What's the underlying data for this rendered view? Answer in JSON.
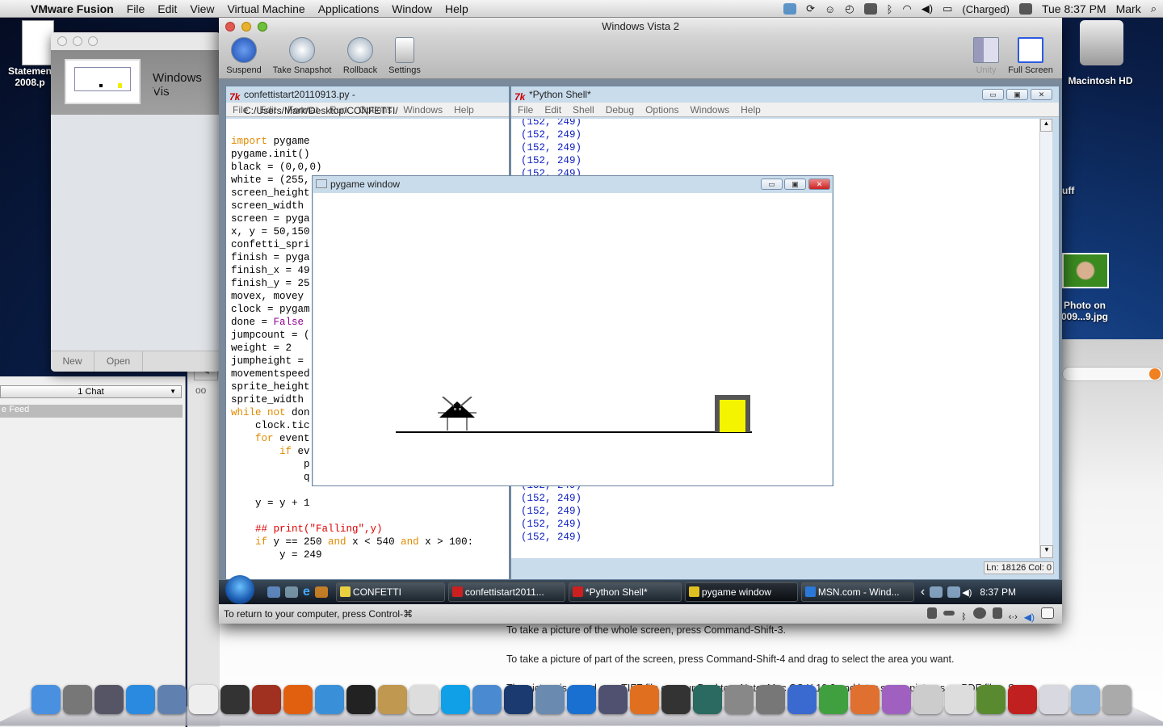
{
  "menubar": {
    "app": "VMware Fusion",
    "items": [
      "File",
      "Edit",
      "View",
      "Virtual Machine",
      "Applications",
      "Window",
      "Help"
    ],
    "battery": "(Charged)",
    "clock": "Tue 8:37 PM",
    "user": "Mark"
  },
  "desktop": {
    "icons": [
      {
        "label": "Statemen 2008.p"
      },
      {
        "label": "Macintosh HD"
      },
      {
        "label": "uff"
      },
      {
        "label": "Photo on 009...9.jpg"
      }
    ]
  },
  "library": {
    "vm_name": "Windows Vis",
    "vm_state": "Running",
    "new": "New",
    "open": "Open"
  },
  "chat": {
    "dropdown": "1 Chat",
    "feed": "e Feed"
  },
  "help": {
    "lines": [
      "To take a picture of the whole screen, press Command-Shift-3.",
      "To take a picture of part of the screen, press Command-Shift-4 and drag to select the area you want.",
      "The picture is saved as a TIFF file on your Desktop. Note: Mac OS X 10.2 and later saves pictures as PDF files. See"
    ]
  },
  "vm": {
    "title": "Windows Vista 2",
    "toolbar": {
      "suspend": "Suspend",
      "snapshot": "Take Snapshot",
      "rollback": "Rollback",
      "settings": "Settings",
      "unity": "Unity",
      "fullscreen": "Full Screen"
    },
    "status": "To return to your computer, press Control-⌘"
  },
  "editor": {
    "title": "confettistart20110913.py - C:/Users/Mark/Desktop/CONFETTI/",
    "menu": [
      "File",
      "Edit",
      "Format",
      "Run",
      "Options",
      "Windows",
      "Help"
    ],
    "lines": [
      [
        [
          "import",
          "kw"
        ],
        [
          " pygame",
          ""
        ]
      ],
      [
        [
          "pygame.init()",
          ""
        ]
      ],
      [
        [
          "black = (0,0,0)",
          ""
        ]
      ],
      [
        [
          "white = (255,",
          ""
        ]
      ],
      [
        [
          "screen_height",
          ""
        ]
      ],
      [
        [
          "screen_width",
          ""
        ]
      ],
      [
        [
          "screen = pyga",
          ""
        ]
      ],
      [
        [
          "x, y = 50,150",
          ""
        ]
      ],
      [
        [
          "confetti_spri",
          ""
        ]
      ],
      [
        [
          "finish = pyga",
          ""
        ]
      ],
      [
        [
          "finish_x = 49",
          ""
        ]
      ],
      [
        [
          "finish_y = 25",
          ""
        ]
      ],
      [
        [
          "movex, movey",
          ""
        ]
      ],
      [
        [
          "clock = pygam",
          ""
        ]
      ],
      [
        [
          "done = ",
          ""
        ],
        [
          "False",
          "bi"
        ]
      ],
      [
        [
          "jumpcount = (",
          ""
        ]
      ],
      [
        [
          "weight = 2",
          ""
        ]
      ],
      [
        [
          "jumpheight =",
          ""
        ]
      ],
      [
        [
          "movementspeed",
          ""
        ]
      ],
      [
        [
          "sprite_height",
          ""
        ]
      ],
      [
        [
          "sprite_width",
          ""
        ]
      ],
      [
        [
          "while not",
          "kw"
        ],
        [
          " don",
          ""
        ]
      ],
      [
        [
          "    clock.tic",
          ""
        ]
      ],
      [
        [
          "    ",
          ""
        ],
        [
          "for",
          "kw"
        ],
        [
          " event",
          ""
        ]
      ],
      [
        [
          "        ",
          ""
        ],
        [
          "if",
          "kw"
        ],
        [
          " ev",
          ""
        ]
      ],
      [
        [
          "            p",
          ""
        ]
      ],
      [
        [
          "            q",
          ""
        ]
      ],
      [
        [
          "",
          ""
        ]
      ],
      [
        [
          "    y = y + 1",
          ""
        ]
      ],
      [
        [
          "",
          ""
        ]
      ],
      [
        [
          "    ## print(\"Falling\",y)",
          "cm"
        ]
      ],
      [
        [
          "    ",
          ""
        ],
        [
          "if",
          "kw"
        ],
        [
          " y == 250 ",
          ""
        ],
        [
          "and",
          "kw"
        ],
        [
          " x < 540 ",
          ""
        ],
        [
          "and",
          "kw"
        ],
        [
          " x > 100:",
          ""
        ]
      ],
      [
        [
          "        y = 249",
          ""
        ]
      ]
    ]
  },
  "shell": {
    "title": "*Python Shell*",
    "menu": [
      "File",
      "Edit",
      "Shell",
      "Debug",
      "Options",
      "Windows",
      "Help"
    ],
    "top_lines": [
      "(152, 249)",
      "(152, 249)",
      "(152, 249)",
      "(152, 249)",
      "(152, 249)"
    ],
    "bottom_lines": [
      "(152, 249)",
      "(152, 249)",
      "(152, 249)",
      "(152, 249)",
      "(152, 249)"
    ],
    "position": "Ln: 18126 Col: 0"
  },
  "pygame": {
    "title": "pygame window"
  },
  "taskbar": {
    "items": [
      {
        "label": "CONFETTI",
        "color": "#e8d040"
      },
      {
        "label": "confettistart2011...",
        "color": "#cc2020"
      },
      {
        "label": "*Python Shell*",
        "color": "#cc2020"
      },
      {
        "label": "pygame window",
        "color": "#e0c020"
      },
      {
        "label": "MSN.com - Wind...",
        "color": "#2a78d8"
      }
    ],
    "clock": "8:37 PM"
  },
  "dock": {
    "icons": [
      {
        "name": "finder",
        "color": "#4a90e0"
      },
      {
        "name": "launchpad",
        "color": "#777"
      },
      {
        "name": "dashboard",
        "color": "#556"
      },
      {
        "name": "app-store",
        "color": "#2a8ae0"
      },
      {
        "name": "preview",
        "color": "#6080b0"
      },
      {
        "name": "calendar",
        "color": "#eee"
      },
      {
        "name": "dvd-player",
        "color": "#333"
      },
      {
        "name": "photo-booth",
        "color": "#a03020"
      },
      {
        "name": "firefox",
        "color": "#e06010"
      },
      {
        "name": "safari",
        "color": "#3a90d8"
      },
      {
        "name": "aperture",
        "color": "#222"
      },
      {
        "name": "address-book",
        "color": "#c09850"
      },
      {
        "name": "textedit",
        "color": "#ddd"
      },
      {
        "name": "skype",
        "color": "#10a0e8"
      },
      {
        "name": "facetime",
        "color": "#4a8ad0"
      },
      {
        "name": "quicktime",
        "color": "#1a3a70"
      },
      {
        "name": "iphoto",
        "color": "#6a8ab0"
      },
      {
        "name": "itunes",
        "color": "#1a70d0"
      },
      {
        "name": "scripteditor",
        "color": "#505070"
      },
      {
        "name": "keynote",
        "color": "#e07020"
      },
      {
        "name": "imovie",
        "color": "#333"
      },
      {
        "name": "time-machine",
        "color": "#2a6a60"
      },
      {
        "name": "scanner",
        "color": "#888"
      },
      {
        "name": "system-preferences",
        "color": "#777"
      },
      {
        "name": "word",
        "color": "#3a6ad0"
      },
      {
        "name": "excel",
        "color": "#40a040"
      },
      {
        "name": "powerpoint",
        "color": "#e07030"
      },
      {
        "name": "entourage",
        "color": "#a060c0"
      },
      {
        "name": "grapher",
        "color": "#ccc"
      },
      {
        "name": "activity-table",
        "color": "#ddd"
      },
      {
        "name": "minecraft",
        "color": "#5a8a30"
      },
      {
        "name": "vmware-fusion",
        "color": "#c02020"
      },
      {
        "name": "documents",
        "color": "#d8d8e0"
      },
      {
        "name": "downloads",
        "color": "#8ab0d8"
      },
      {
        "name": "trash",
        "color": "#aaa"
      }
    ]
  }
}
